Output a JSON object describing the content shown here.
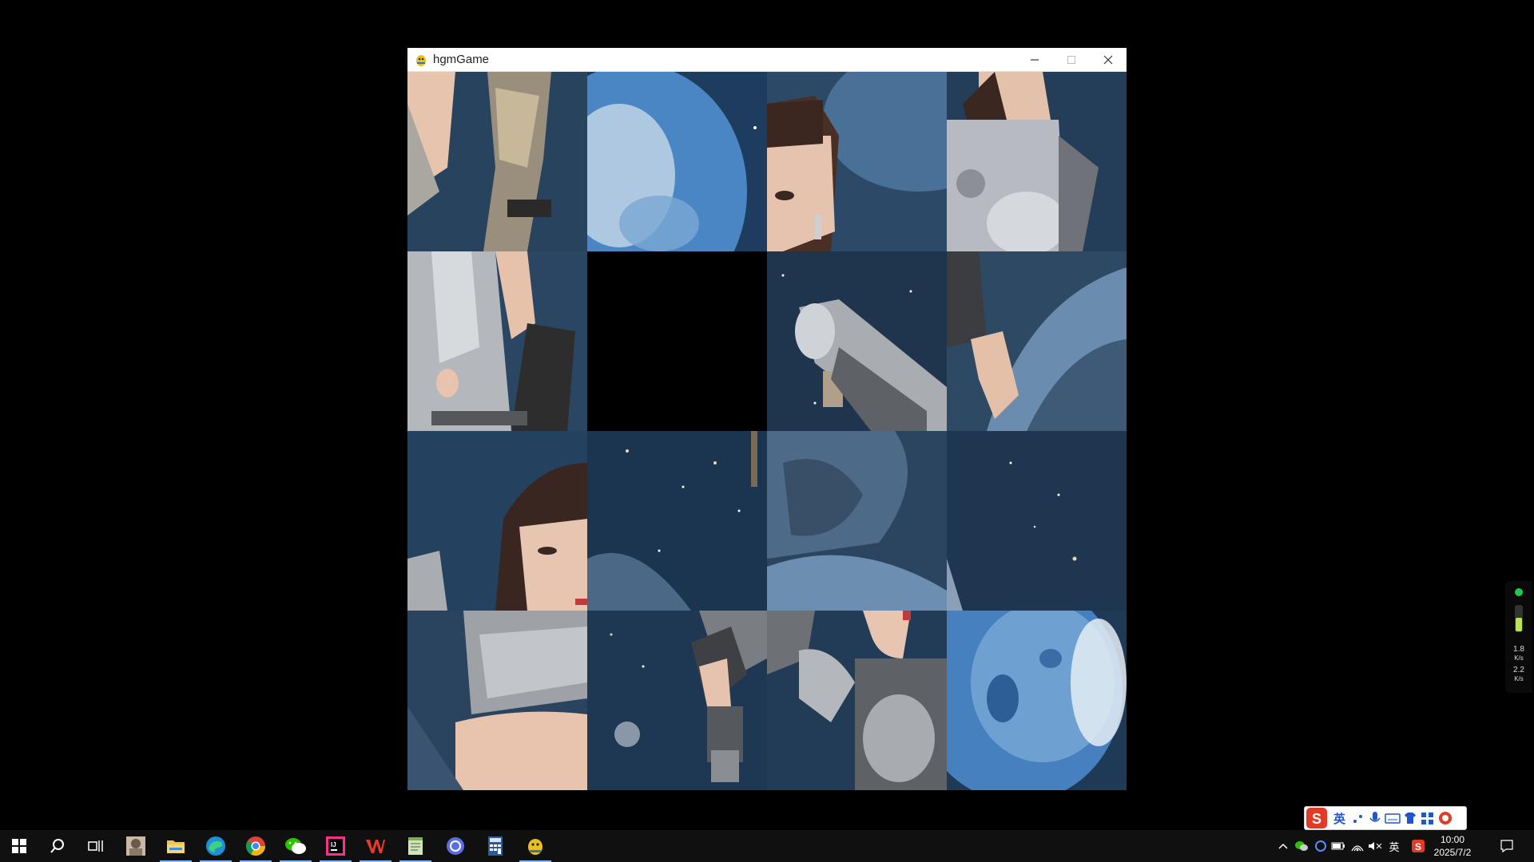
{
  "window": {
    "title": "hgmGame",
    "controls": {
      "minimize": "—",
      "maximize": "☐",
      "close": "✕"
    }
  },
  "puzzle": {
    "grid_rows": 4,
    "grid_cols": 4,
    "empty_tile": {
      "row": 1,
      "col": 1
    },
    "tiles": [
      {
        "row": 0,
        "col": 0,
        "desc": "armor-arm"
      },
      {
        "row": 0,
        "col": 1,
        "desc": "planet-left"
      },
      {
        "row": 0,
        "col": 2,
        "desc": "face-bangs"
      },
      {
        "row": 0,
        "col": 3,
        "desc": "armor-chest"
      },
      {
        "row": 1,
        "col": 0,
        "desc": "armor-torso"
      },
      {
        "row": 1,
        "col": 2,
        "desc": "pistol"
      },
      {
        "row": 1,
        "col": 3,
        "desc": "hand-moon"
      },
      {
        "row": 2,
        "col": 0,
        "desc": "face-girl"
      },
      {
        "row": 2,
        "col": 1,
        "desc": "space-stars"
      },
      {
        "row": 2,
        "col": 2,
        "desc": "moon-surface"
      },
      {
        "row": 2,
        "col": 3,
        "desc": "space-dark"
      },
      {
        "row": 3,
        "col": 0,
        "desc": "armor-skirt"
      },
      {
        "row": 3,
        "col": 1,
        "desc": "hand-gun"
      },
      {
        "row": 3,
        "col": 2,
        "desc": "shoulder-armor"
      },
      {
        "row": 3,
        "col": 3,
        "desc": "planet-right"
      }
    ]
  },
  "taskbar": {
    "apps": [
      "start-icon",
      "search-icon",
      "task-view-icon",
      "photo-app-icon",
      "file-explorer-icon",
      "edge-icon",
      "chrome-icon",
      "wechat-icon",
      "intellij-icon",
      "wps-icon",
      "notepad-icon",
      "app-circle-icon",
      "calculator-icon",
      "pygame-icon"
    ],
    "tray": {
      "lang": "英",
      "time": "10:00",
      "date": "2025/7/2"
    }
  },
  "ime_bar": {
    "mode": "英"
  },
  "net_widget": {
    "up": "1.8",
    "up_unit": "K/s",
    "down": "2.2",
    "down_unit": "K/s"
  },
  "colors": {
    "space": "#1c3550",
    "armor": "#b9bcc2",
    "planet": "#4a86c4",
    "skin": "#e8c0a8"
  }
}
